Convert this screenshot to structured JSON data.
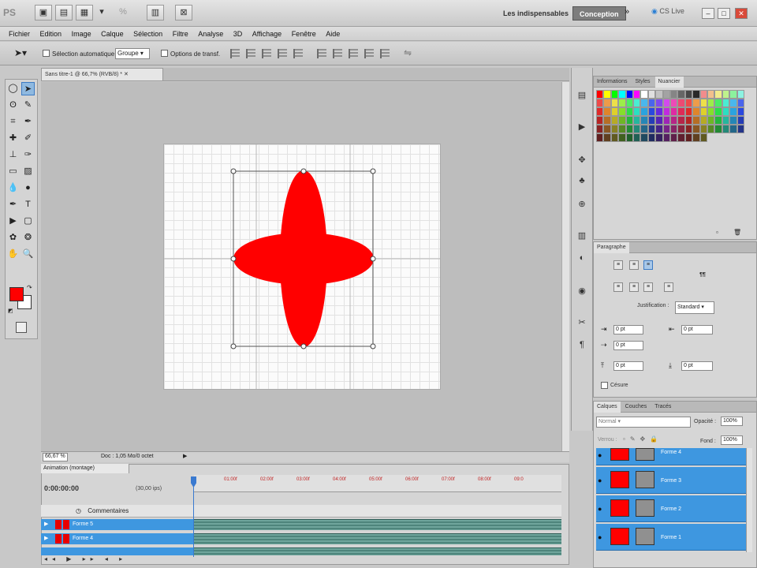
{
  "app": {
    "logo": "PS",
    "workspace_essentials": "Les indispensables",
    "workspace_design": "Conception",
    "cs_live": "CS Live",
    "more": "»"
  },
  "menu": [
    "Fichier",
    "Edition",
    "Image",
    "Calque",
    "Sélection",
    "Filtre",
    "Analyse",
    "3D",
    "Affichage",
    "Fenêtre",
    "Aide"
  ],
  "options": {
    "auto_select": "Sélection automatique :",
    "auto_select_value": "Groupe",
    "transform_controls": "Options de transf."
  },
  "document": {
    "tab_title": "Sans titre-1 @ 66,7% (RVB/8) *",
    "zoom": "66,67 %",
    "doc_info": "Doc : 1,05 Mo/0 octet"
  },
  "timeline": {
    "tab": "Animation (montage)",
    "time": "0:00:00:00",
    "fps": "(30,00 ips)",
    "ticks": [
      "01:00f",
      "02:00f",
      "03:00f",
      "04:00f",
      "05:00f",
      "06:00f",
      "07:00f",
      "08:00f",
      "09:0"
    ],
    "comments": "Commentaires",
    "layers": [
      "Forme 5",
      "Forme 4"
    ]
  },
  "panels": {
    "swatch_tabs": [
      "Informations",
      "Styles",
      "Nuancier"
    ],
    "paragraph_tab": "Paragraphe",
    "justification_label": "Justification :",
    "justification_value": "Standard",
    "fields": [
      "0 pt",
      "0 pt",
      "0 pt",
      "0 pt",
      "0 pt"
    ],
    "hyphenation": "Césure",
    "layers_tabs": [
      "Calques",
      "Couches",
      "Tracés"
    ],
    "blend_mode": "Normal",
    "opacity_label": "Opacité :",
    "opacity_value": "100%",
    "lock_label": "Verrou :",
    "fill_label": "Fond :",
    "fill_value": "100%",
    "layers": [
      "Forme 4",
      "Forme 3",
      "Forme 2",
      "Forme 1"
    ]
  },
  "colors": {
    "foreground": "#ff0000",
    "background": "#ffffff",
    "shape": "#ff0000",
    "selection": "#3e97e0"
  }
}
